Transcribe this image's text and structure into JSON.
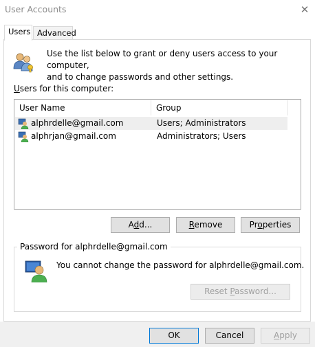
{
  "window": {
    "title": "User Accounts",
    "close_glyph": "✕"
  },
  "tabs": [
    {
      "label": "Users",
      "active": true
    },
    {
      "label": "Advanced",
      "active": false
    }
  ],
  "intro": {
    "icon": "users-icon",
    "line1": "Use the list below to grant or deny users access to your computer,",
    "line2": "and to change passwords and other settings."
  },
  "users_list": {
    "label_prefix": "",
    "label_access_key": "U",
    "label_rest": "sers for this computer:",
    "columns": [
      "User Name",
      "Group"
    ],
    "rows": [
      {
        "name": "alphrdelle@gmail.com",
        "group": "Users; Administrators",
        "selected": true
      },
      {
        "name": "alphrjan@gmail.com",
        "group": "Administrators; Users",
        "selected": false
      }
    ]
  },
  "list_buttons": {
    "add": {
      "before": "A",
      "key": "d",
      "after": "d..."
    },
    "remove": {
      "before": "",
      "key": "R",
      "after": "emove"
    },
    "properties": {
      "before": "Pr",
      "key": "o",
      "after": "perties"
    }
  },
  "password": {
    "legend": "Password for alphrdelle@gmail.com",
    "icon": "user-password-icon",
    "message": "You cannot change the password for alphrdelle@gmail.com.",
    "reset": {
      "before": "Reset ",
      "key": "P",
      "after": "assword...",
      "enabled": false
    }
  },
  "footer": {
    "ok": "OK",
    "cancel": "Cancel",
    "apply": {
      "before": "",
      "key": "A",
      "after": "pply",
      "enabled": false
    }
  },
  "colors": {
    "accent": "#0078d7",
    "button_face": "#e1e1e1",
    "disabled_text": "#a0a0a0"
  }
}
